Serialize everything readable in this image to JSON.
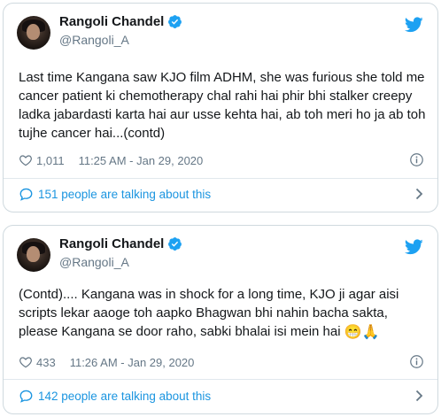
{
  "tweets": [
    {
      "display_name": "Rangoli Chandel",
      "handle": "@Rangoli_A",
      "text": "Last time Kangana saw KJO film ADHM, she was furious she told me cancer patient ki chemotherapy chal rahi hai phir bhi stalker creepy ladka jabardasti karta hai aur usse kehta hai, ab toh meri ho ja ab toh tujhe cancer hai...(contd)",
      "emoji": "",
      "likes": "1,011",
      "timestamp": "11:25 AM - Jan 29, 2020",
      "talking": "151 people are talking about this",
      "icons": {
        "avatar": "avatar",
        "verified": "verified-badge-icon",
        "brand": "twitter-bird-icon",
        "like": "heart-icon",
        "info": "info-icon",
        "talk": "speech-bubble-icon",
        "chevron": "chevron-right-icon"
      }
    },
    {
      "display_name": "Rangoli Chandel",
      "handle": "@Rangoli_A",
      "text": "(Contd).... Kangana was in shock for a long time, KJO ji agar aisi scripts lekar aaoge toh aapko Bhagwan bhi nahin bacha sakta, please Kangana se door raho, sabki bhalai isi mein hai",
      "emoji": "😁🙏",
      "likes": "433",
      "timestamp": "11:26 AM - Jan 29, 2020",
      "talking": "142 people are talking about this",
      "icons": {
        "avatar": "avatar",
        "verified": "verified-badge-icon",
        "brand": "twitter-bird-icon",
        "like": "heart-icon",
        "info": "info-icon",
        "talk": "speech-bubble-icon",
        "chevron": "chevron-right-icon"
      }
    }
  ],
  "colors": {
    "accent": "#1da1f2",
    "link": "#1b95e0",
    "text": "#14171a",
    "muted": "#657786",
    "border": "#cfd9de"
  }
}
